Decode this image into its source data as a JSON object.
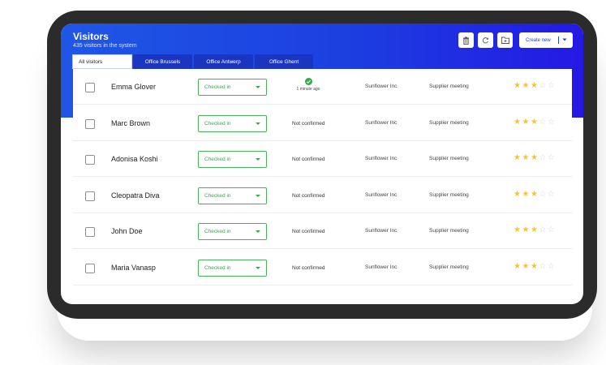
{
  "header": {
    "title": "Visitors",
    "subtitle": "435 visitors in the system",
    "create_label": "Create new",
    "toolbar_icons": [
      "trash-icon",
      "refresh-icon",
      "folder-icon"
    ]
  },
  "tabs": [
    {
      "label": "All visitors",
      "active": true
    },
    {
      "label": "Office Brussels",
      "active": false
    },
    {
      "label": "Office Antwerp",
      "active": false
    },
    {
      "label": "Office Ghent",
      "active": false
    }
  ],
  "colors": {
    "accent": "#1c3fe0",
    "status_green": "#38a84b",
    "star": "#f7c13a"
  },
  "visitors": [
    {
      "name": "Emma Glover",
      "status": "Checked in",
      "confirmed": true,
      "confirmation": "1 minute ago",
      "company": "Sunflower Inc",
      "purpose": "Supplier meeting",
      "rating": 3
    },
    {
      "name": "Marc Brown",
      "status": "Checked in",
      "confirmed": false,
      "confirmation": "Not confirmed",
      "company": "Sunflower Inc",
      "purpose": "Supplier meeting",
      "rating": 3
    },
    {
      "name": "Adonisa Koshi",
      "status": "Checked in",
      "confirmed": false,
      "confirmation": "Not confirmed",
      "company": "Sunflower Inc",
      "purpose": "Supplier meeting",
      "rating": 3
    },
    {
      "name": "Cleopatra Diva",
      "status": "Checked in",
      "confirmed": false,
      "confirmation": "Not confirmed",
      "company": "Sunflower Inc",
      "purpose": "Supplier meeting",
      "rating": 3
    },
    {
      "name": "John Doe",
      "status": "Checked in",
      "confirmed": false,
      "confirmation": "Not confirmed",
      "company": "Sunflower Inc",
      "purpose": "Supplier meeting",
      "rating": 3
    },
    {
      "name": "Maria Vanasp",
      "status": "Checked in",
      "confirmed": false,
      "confirmation": "Not confirmed",
      "company": "Sunflower Inc",
      "purpose": "Supplier meeting",
      "rating": 3
    }
  ],
  "rating_max": 5
}
